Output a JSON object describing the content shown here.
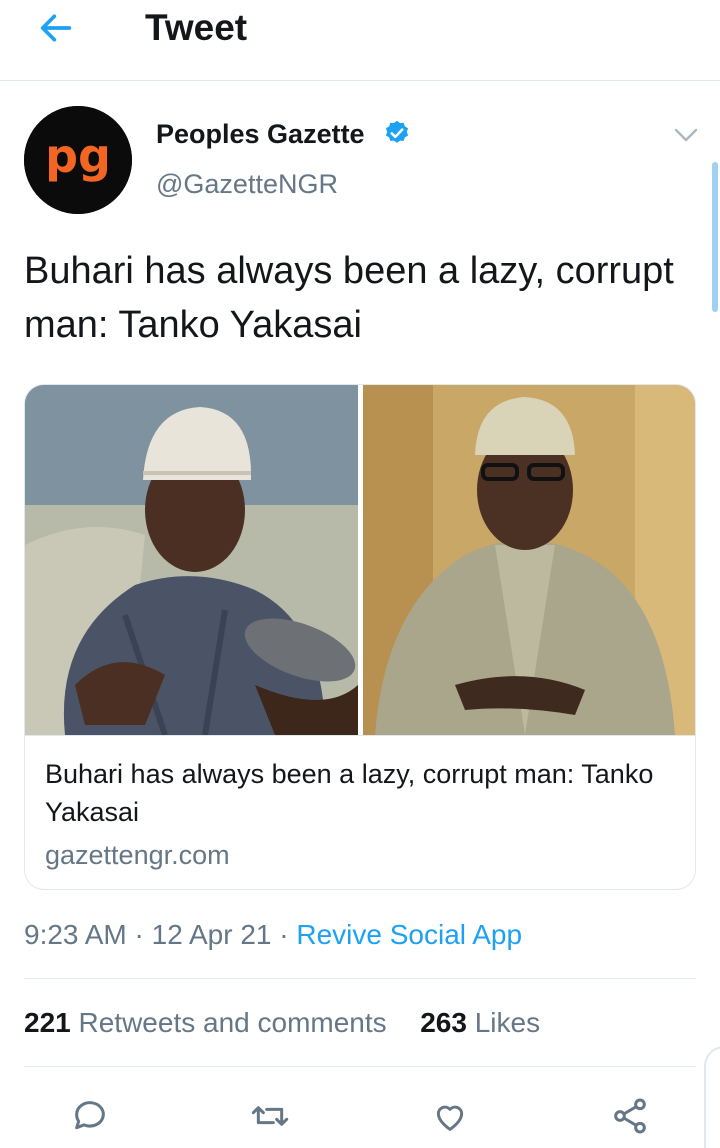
{
  "header": {
    "title": "Tweet",
    "back_icon": "arrow-left-icon"
  },
  "author": {
    "avatar_text": "pg",
    "name": "Peoples Gazette",
    "verified": true,
    "handle": "@GazetteNGR"
  },
  "tweet": {
    "text": "Buhari has always been a lazy, corrupt man: Tanko Yakasai"
  },
  "card": {
    "title": "Buhari has always been a lazy, corrupt man: Tanko Yakasai",
    "domain": "gazettengr.com"
  },
  "meta": {
    "time": "9:23 AM",
    "separator": " · ",
    "date": "12 Apr 21",
    "source": "Revive Social App"
  },
  "stats": {
    "retweets_count": "221",
    "retweets_label": "Retweets and comments",
    "likes_count": "263",
    "likes_label": "Likes"
  },
  "actions": [
    "reply-icon",
    "retweet-icon",
    "like-icon",
    "share-icon"
  ],
  "colors": {
    "accent": "#1da1f2",
    "secondary_text": "#657786",
    "brand_orange": "#f26522"
  }
}
